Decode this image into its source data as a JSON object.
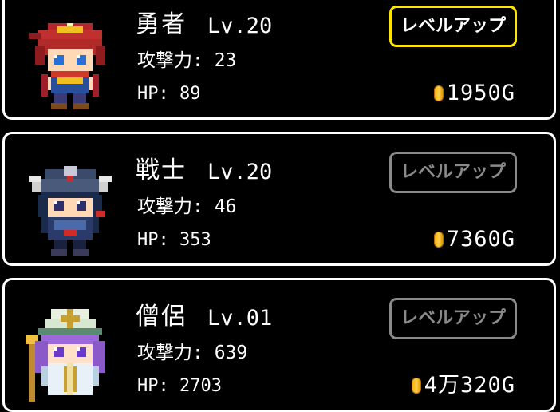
{
  "characters": [
    {
      "portrait": "hero-portrait-icon",
      "name": "勇者",
      "level": "Lv.20",
      "attack": "攻撃力: 23",
      "hp": "HP: 89",
      "button": "レベルアップ",
      "button_state": "enabled",
      "gold": "1950G"
    },
    {
      "portrait": "warrior-portrait-icon",
      "name": "戦士",
      "level": "Lv.20",
      "attack": "攻撃力: 46",
      "hp": "HP: 353",
      "button": "レベルアップ",
      "button_state": "disabled",
      "gold": "7360G"
    },
    {
      "portrait": "priest-portrait-icon",
      "name": "僧侶",
      "level": "Lv.01",
      "attack": "攻撃力: 639",
      "hp": "HP: 2703",
      "button": "レベルアップ",
      "button_state": "disabled",
      "gold": "4万320G"
    }
  ],
  "colors": {
    "background": "#000000",
    "card_border": "#ffffff",
    "button_active_border": "#ffe400",
    "button_disabled": "#8a8a8a",
    "coin": "#f5b400"
  }
}
